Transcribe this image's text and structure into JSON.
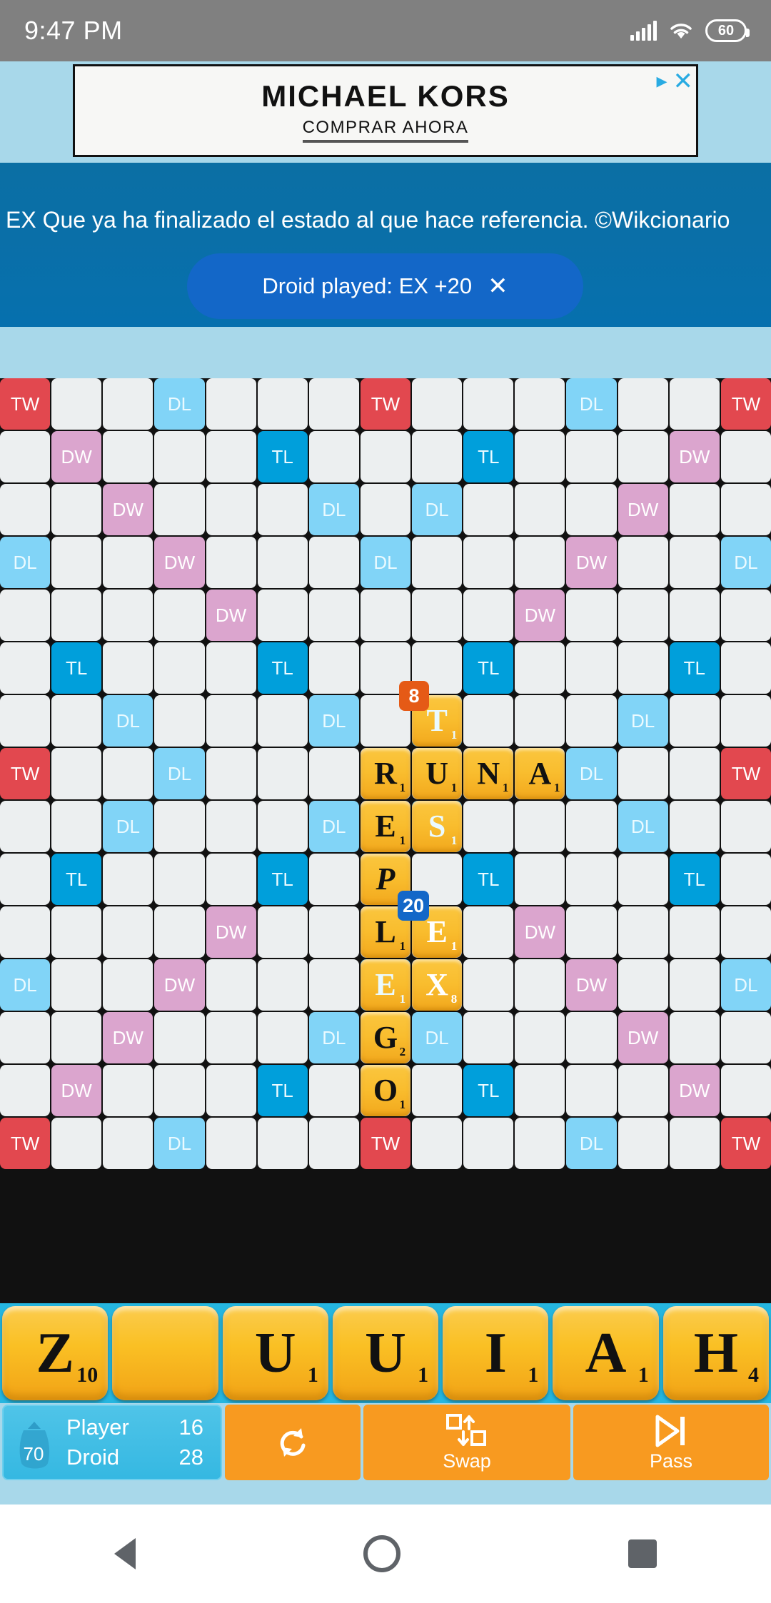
{
  "status_bar": {
    "clock": "9:47 PM",
    "battery_level": "60",
    "signal_icon": "signal-bars-icon",
    "wifi_icon": "wifi-icon",
    "battery_icon": "battery-icon"
  },
  "ad": {
    "title": "MICHAEL KORS",
    "subtitle": "COMPRAR AHORA",
    "adchoices_icon": "adchoices-icon",
    "close_icon": "close-icon",
    "close_label": "✕"
  },
  "definition": {
    "text": "EX Que ya ha finalizado el estado al que hace referencia. ©Wikcionario"
  },
  "toast": {
    "message": "Droid played:  EX  +20",
    "close_label": "✕"
  },
  "colors": {
    "triple_word": "#e2484f",
    "double_word": "#dba5ce",
    "triple_letter": "#009fdb",
    "double_letter": "#81d4f7",
    "empty_cell": "#eceff0",
    "tile": "#fac63f",
    "board_bg": "#111111",
    "page_bg": "#a8d8ea",
    "rack_bg": "#25b6e0",
    "button": "#f89a20",
    "banner": "#0b6fa4",
    "badge_new": "#1367c8",
    "badge_prev": "#e55a16"
  },
  "board": {
    "size": 15,
    "premium_labels": {
      "tw": "TW",
      "dw": "DW",
      "tl": "TL",
      "dl": "DL"
    },
    "premium_map": [
      [
        "tw",
        "",
        "",
        "dl",
        "",
        "",
        "",
        "tw",
        "",
        "",
        "",
        "dl",
        "",
        "",
        "tw"
      ],
      [
        "",
        "dw",
        "",
        "",
        "",
        "tl",
        "",
        "",
        "",
        "tl",
        "",
        "",
        "",
        "dw",
        ""
      ],
      [
        "",
        "",
        "dw",
        "",
        "",
        "",
        "dl",
        "",
        "dl",
        "",
        "",
        "",
        "dw",
        "",
        ""
      ],
      [
        "dl",
        "",
        "",
        "dw",
        "",
        "",
        "",
        "dl",
        "",
        "",
        "",
        "dw",
        "",
        "",
        "dl"
      ],
      [
        "",
        "",
        "",
        "",
        "dw",
        "",
        "",
        "",
        "",
        "",
        "dw",
        "",
        "",
        "",
        ""
      ],
      [
        "",
        "tl",
        "",
        "",
        "",
        "tl",
        "",
        "",
        "",
        "tl",
        "",
        "",
        "",
        "tl",
        ""
      ],
      [
        "",
        "",
        "dl",
        "",
        "",
        "",
        "dl",
        "",
        "dl",
        "",
        "",
        "",
        "dl",
        "",
        ""
      ],
      [
        "tw",
        "",
        "",
        "dl",
        "",
        "",
        "",
        "",
        "",
        "",
        "",
        "dl",
        "",
        "",
        "tw"
      ],
      [
        "",
        "",
        "dl",
        "",
        "",
        "",
        "dl",
        "",
        "dl",
        "",
        "",
        "",
        "dl",
        "",
        ""
      ],
      [
        "",
        "tl",
        "",
        "",
        "",
        "tl",
        "",
        "",
        "",
        "tl",
        "",
        "",
        "",
        "tl",
        ""
      ],
      [
        "",
        "",
        "",
        "",
        "dw",
        "",
        "",
        "",
        "",
        "",
        "dw",
        "",
        "",
        "",
        ""
      ],
      [
        "dl",
        "",
        "",
        "dw",
        "",
        "",
        "",
        "dl",
        "",
        "",
        "",
        "dw",
        "",
        "",
        "dl"
      ],
      [
        "",
        "",
        "dw",
        "",
        "",
        "",
        "dl",
        "",
        "dl",
        "",
        "",
        "",
        "dw",
        "",
        ""
      ],
      [
        "",
        "dw",
        "",
        "",
        "",
        "tl",
        "",
        "",
        "",
        "tl",
        "",
        "",
        "",
        "dw",
        ""
      ],
      [
        "tw",
        "",
        "",
        "dl",
        "",
        "",
        "",
        "tw",
        "",
        "",
        "",
        "dl",
        "",
        "",
        "tw"
      ]
    ],
    "placed_tiles": [
      {
        "row": 6,
        "col": 8,
        "letter": "T",
        "value": "1",
        "blank": false,
        "fresh": false,
        "badge": "8",
        "badge_type": "orange"
      },
      {
        "row": 7,
        "col": 7,
        "letter": "R",
        "value": "1",
        "blank": false,
        "fresh": false,
        "badge": "",
        "badge_type": ""
      },
      {
        "row": 7,
        "col": 8,
        "letter": "U",
        "value": "1",
        "blank": false,
        "fresh": false,
        "badge": "",
        "badge_type": ""
      },
      {
        "row": 7,
        "col": 9,
        "letter": "N",
        "value": "1",
        "blank": false,
        "fresh": false,
        "badge": "",
        "badge_type": ""
      },
      {
        "row": 7,
        "col": 10,
        "letter": "A",
        "value": "1",
        "blank": false,
        "fresh": false,
        "badge": "",
        "badge_type": ""
      },
      {
        "row": 8,
        "col": 7,
        "letter": "E",
        "value": "1",
        "blank": false,
        "fresh": false,
        "badge": "",
        "badge_type": ""
      },
      {
        "row": 8,
        "col": 8,
        "letter": "S",
        "value": "1",
        "blank": false,
        "fresh": false,
        "badge": "",
        "badge_type": ""
      },
      {
        "row": 9,
        "col": 7,
        "letter": "P",
        "value": "0",
        "blank": true,
        "fresh": false,
        "badge": "",
        "badge_type": ""
      },
      {
        "row": 10,
        "col": 7,
        "letter": "L",
        "value": "1",
        "blank": false,
        "fresh": false,
        "badge": "",
        "badge_type": ""
      },
      {
        "row": 10,
        "col": 8,
        "letter": "E",
        "value": "1",
        "blank": false,
        "fresh": true,
        "badge": "20",
        "badge_type": "blue"
      },
      {
        "row": 11,
        "col": 7,
        "letter": "E",
        "value": "1",
        "blank": false,
        "fresh": false,
        "badge": "",
        "badge_type": ""
      },
      {
        "row": 11,
        "col": 8,
        "letter": "X",
        "value": "8",
        "blank": false,
        "fresh": true,
        "badge": "",
        "badge_type": ""
      },
      {
        "row": 12,
        "col": 7,
        "letter": "G",
        "value": "2",
        "blank": false,
        "fresh": false,
        "badge": "",
        "badge_type": ""
      },
      {
        "row": 13,
        "col": 7,
        "letter": "O",
        "value": "1",
        "blank": false,
        "fresh": false,
        "badge": "",
        "badge_type": ""
      }
    ]
  },
  "rack": {
    "tiles": [
      {
        "letter": "Z",
        "value": "10"
      },
      {
        "letter": "",
        "value": ""
      },
      {
        "letter": "U",
        "value": "1"
      },
      {
        "letter": "U",
        "value": "1"
      },
      {
        "letter": "I",
        "value": "1"
      },
      {
        "letter": "A",
        "value": "1"
      },
      {
        "letter": "H",
        "value": "4"
      }
    ]
  },
  "controls": {
    "bag_icon": "tile-bag-icon",
    "bag_count": "70",
    "players": [
      {
        "name": "Player",
        "score": "16"
      },
      {
        "name": "Droid",
        "score": "28"
      }
    ],
    "shuffle": {
      "icon": "shuffle-icon",
      "label": ""
    },
    "swap": {
      "icon": "swap-icon",
      "label": "Swap"
    },
    "pass": {
      "icon": "pass-icon",
      "label": "Pass"
    }
  },
  "navbar": {
    "back_icon": "nav-back-icon",
    "home_icon": "nav-home-icon",
    "recents_icon": "nav-recents-icon"
  }
}
